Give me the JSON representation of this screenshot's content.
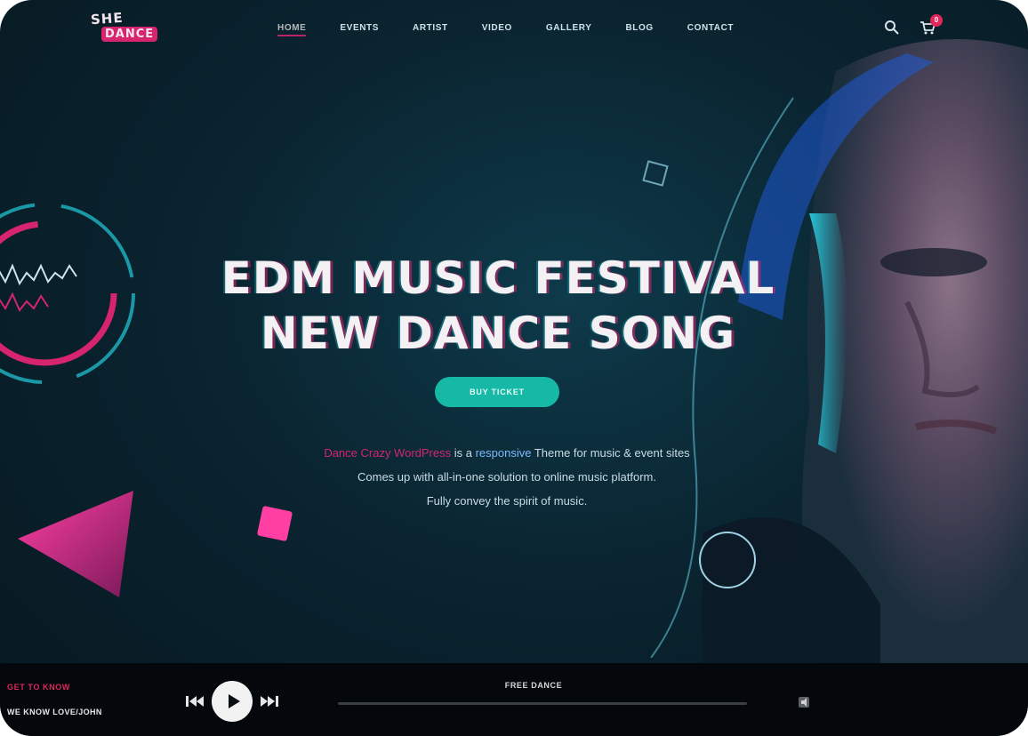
{
  "header": {
    "logo_top": "SHE",
    "logo_bottom": "DANCE",
    "nav": [
      {
        "label": "HOME"
      },
      {
        "label": "EVENTS"
      },
      {
        "label": "ARTIST"
      },
      {
        "label": "VIDEO"
      },
      {
        "label": "GALLERY"
      },
      {
        "label": "BLOG"
      },
      {
        "label": "CONTACT"
      }
    ],
    "cart_count": "0"
  },
  "hero": {
    "title_line1": "EDM MUSIC FESTIVAL",
    "title_line2": "NEW DANCE SONG",
    "cta_label": "BUY TICKET",
    "desc_line1_highlight": "Dance Crazy WordPress",
    "desc_line1_mid": " is a ",
    "desc_line1_link": "responsive",
    "desc_line1_rest": " Theme for music & event sites",
    "desc_line2": "Comes up with all-in-one solution to online music platform.",
    "desc_line3": "Fully convey the spirit of music."
  },
  "player": {
    "now_label": "GET TO KNOW",
    "track_artist": "WE KNOW LOVE/JOHN",
    "track_title": "FREE DANCE",
    "progress": 0.0
  },
  "colors": {
    "accent_pink": "#d6246f",
    "accent_teal": "#16b8a6",
    "bg_dark": "#0a2430"
  }
}
